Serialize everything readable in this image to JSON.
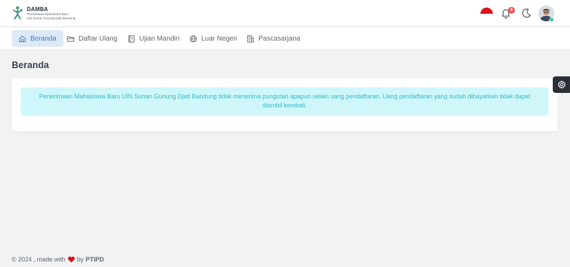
{
  "brand": {
    "name": "DAMBA",
    "subtitle_line1": "Pendaftaran Mahasiswa Baru",
    "subtitle_line2": "UIN Sunan Gunung Djati Bandung"
  },
  "header": {
    "notification_count": "9"
  },
  "nav": {
    "items": [
      {
        "label": "Beranda",
        "icon": "home-icon",
        "active": true
      },
      {
        "label": "Daftar Ulang",
        "icon": "folder-icon"
      },
      {
        "label": "Ujian Mandiri",
        "icon": "book-icon"
      },
      {
        "label": "Luar Negeri",
        "icon": "globe-icon"
      },
      {
        "label": "Pascasarjana",
        "icon": "building-icon"
      }
    ]
  },
  "main": {
    "title": "Beranda",
    "alert": "Penerimaan Mahasiswa Baru UIN Sunan Gunung Djati Bandung tidak menerima pungutan apapun selain uang pendaftaran. Uang pendaftaran yang sudah dibayarkan tidak dapat diambil kembali."
  },
  "footer": {
    "prefix": "© 2024 , made with",
    "by": "by",
    "org": "PTIPD"
  },
  "colors": {
    "accent": "#3a80c6",
    "alert_bg": "#cff7fa",
    "alert_text": "#34b9c8",
    "badge": "#ea5455",
    "online": "#28c76f"
  }
}
